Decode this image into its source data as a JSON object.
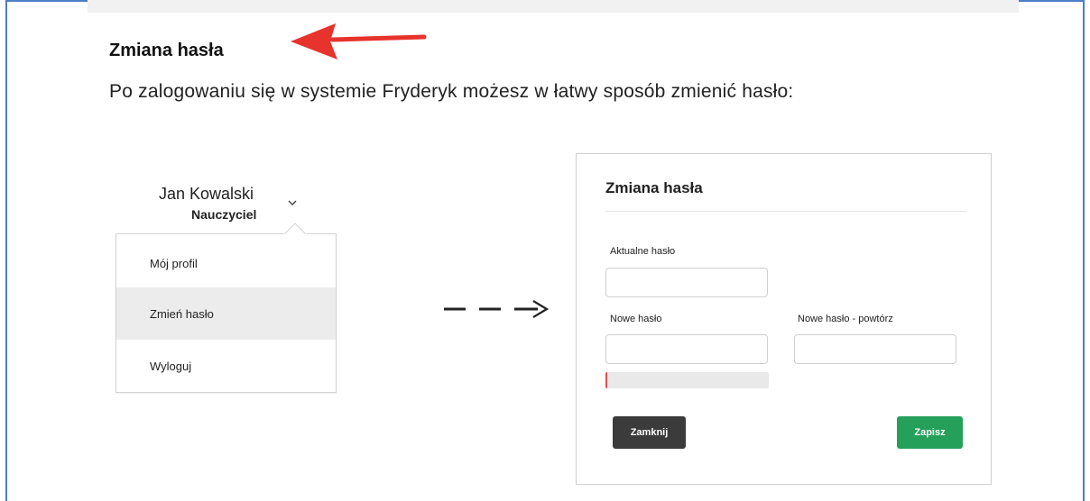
{
  "doc": {
    "title": "Zmiana hasła",
    "intro": "Po zalogowaniu się w systemie Fryderyk możesz w łatwy sposób zmienić hasło:"
  },
  "user": {
    "name": "Jan Kowalski",
    "role": "Nauczyciel"
  },
  "menu": {
    "items": [
      {
        "label": "Mój profil"
      },
      {
        "label": "Zmień hasło"
      },
      {
        "label": "Wyloguj"
      }
    ]
  },
  "modal": {
    "title": "Zmiana hasła",
    "current_password_label": "Aktualne hasło",
    "current_password_value": "",
    "new_password_label": "Nowe hasło",
    "new_password_value": "",
    "repeat_password_label": "Nowe hasło - powtórz",
    "repeat_password_value": "",
    "strength_fraction": 0.01,
    "close_label": "Zamknij",
    "save_label": "Zapisz"
  },
  "colors": {
    "frame": "#4d7ec6",
    "pointer_arrow": "#e8322c",
    "close_button": "#3b3b3b",
    "save_button": "#25a05a",
    "strength_fill": "#d9534f"
  },
  "icons": {
    "pointer": "red-arrow-left-icon",
    "dropdown": "chevron-down-icon",
    "flow": "dashed-arrow-right-icon"
  }
}
